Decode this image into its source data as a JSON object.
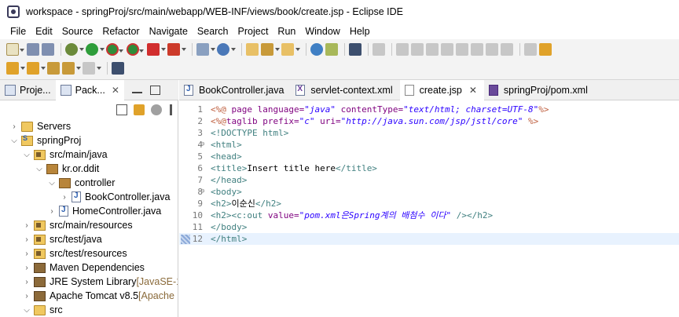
{
  "window": {
    "title": "workspace - springProj/src/main/webapp/WEB-INF/views/book/create.jsp - Eclipse IDE"
  },
  "menu": [
    "File",
    "Edit",
    "Source",
    "Refactor",
    "Navigate",
    "Search",
    "Project",
    "Run",
    "Window",
    "Help"
  ],
  "left_panel": {
    "tabs": [
      {
        "label": "Proje...",
        "active": false
      },
      {
        "label": "Pack...",
        "active": true
      }
    ]
  },
  "tree": [
    {
      "label": "Servers",
      "depth": 0,
      "twisty": "collapsed",
      "icon": "folder-icon"
    },
    {
      "label": "springProj",
      "depth": 0,
      "twisty": "expanded",
      "icon": "project-icon"
    },
    {
      "label": "src/main/java",
      "depth": 1,
      "twisty": "expanded",
      "icon": "source-folder-icon"
    },
    {
      "label": "kr.or.ddit",
      "depth": 2,
      "twisty": "expanded",
      "icon": "package-icon"
    },
    {
      "label": "controller",
      "depth": 3,
      "twisty": "expanded",
      "icon": "package-icon"
    },
    {
      "label": "BookController.java",
      "depth": 4,
      "twisty": "collapsed",
      "icon": "java-file-icon"
    },
    {
      "label": "HomeController.java",
      "depth": 3,
      "twisty": "collapsed",
      "icon": "java-file-icon"
    },
    {
      "label": "src/main/resources",
      "depth": 1,
      "twisty": "collapsed",
      "icon": "source-folder-icon"
    },
    {
      "label": "src/test/java",
      "depth": 1,
      "twisty": "collapsed",
      "icon": "source-folder-icon"
    },
    {
      "label": "src/test/resources",
      "depth": 1,
      "twisty": "collapsed",
      "icon": "source-folder-icon"
    },
    {
      "label": "Maven Dependencies",
      "depth": 1,
      "twisty": "collapsed",
      "icon": "library-icon"
    },
    {
      "label": "JRE System Library",
      "decoration": "[JavaSE-1",
      "depth": 1,
      "twisty": "collapsed",
      "icon": "library-icon"
    },
    {
      "label": "Apache Tomcat v8.5",
      "decoration": "[Apache",
      "depth": 1,
      "twisty": "collapsed",
      "icon": "library-icon"
    },
    {
      "label": "src",
      "depth": 1,
      "twisty": "expanded",
      "icon": "folder-icon"
    }
  ],
  "editor": {
    "tabs": [
      {
        "label": "BookController.java",
        "icon": "java-file-icon",
        "active": false,
        "closable": false
      },
      {
        "label": "servlet-context.xml",
        "icon": "xml-file-icon",
        "active": false,
        "closable": false
      },
      {
        "label": "create.jsp",
        "icon": "jsp-file-icon",
        "active": true,
        "closable": true
      },
      {
        "label": "springProj/pom.xml",
        "icon": "maven-file-icon",
        "active": false,
        "closable": false
      }
    ],
    "close_glyph": "✕",
    "current_line": 12,
    "lines": [
      {
        "n": "1",
        "fold": "",
        "segs": [
          [
            "dir",
            "<%@ "
          ],
          [
            "attr",
            "page "
          ],
          [
            "attr",
            "language="
          ],
          [
            "str",
            "\"java\""
          ],
          [
            "attr",
            " contentType="
          ],
          [
            "str",
            "\"text/html; charset=UTF-8\""
          ],
          [
            "dir",
            "%>"
          ]
        ]
      },
      {
        "n": "2",
        "fold": "",
        "segs": [
          [
            "dir",
            "<%@"
          ],
          [
            "attr",
            "taglib "
          ],
          [
            "attr",
            "prefix="
          ],
          [
            "str",
            "\"c\""
          ],
          [
            "attr",
            " uri="
          ],
          [
            "str",
            "\"http://java.sun.com/jsp/jstl/core\""
          ],
          [
            "dir",
            " %>"
          ]
        ]
      },
      {
        "n": "3",
        "fold": "",
        "segs": [
          [
            "tag",
            "<!DOCTYPE html>"
          ]
        ]
      },
      {
        "n": "4",
        "fold": "⊖",
        "segs": [
          [
            "tag",
            "<html>"
          ]
        ]
      },
      {
        "n": "5",
        "fold": "",
        "segs": [
          [
            "tag",
            "<head>"
          ]
        ]
      },
      {
        "n": "6",
        "fold": "",
        "segs": [
          [
            "tag",
            "<title>"
          ],
          [
            "txt",
            "Insert title here"
          ],
          [
            "tag",
            "</title>"
          ]
        ]
      },
      {
        "n": "7",
        "fold": "",
        "segs": [
          [
            "tag",
            "</head>"
          ]
        ]
      },
      {
        "n": "8",
        "fold": "⊖",
        "segs": [
          [
            "tag",
            "<body>"
          ]
        ]
      },
      {
        "n": "9",
        "fold": "",
        "segs": [
          [
            "tag",
            "<h2>"
          ],
          [
            "txt",
            "이순신"
          ],
          [
            "tag",
            "</h2>"
          ]
        ]
      },
      {
        "n": "10",
        "fold": "",
        "segs": [
          [
            "tag",
            "<h2><c:out "
          ],
          [
            "attr",
            "value="
          ],
          [
            "str",
            "\"pom.xml은Spring계의 배첨수 이다\""
          ],
          [
            "tag",
            " /></h2>"
          ]
        ]
      },
      {
        "n": "11",
        "fold": "",
        "segs": [
          [
            "tag",
            "</body>"
          ]
        ]
      },
      {
        "n": "12",
        "fold": "",
        "segs": [
          [
            "tag",
            "</html>"
          ]
        ]
      }
    ]
  },
  "colors": {
    "directive": "#bf5f3f",
    "attribute": "#7f007f",
    "string": "#2a00ff",
    "tag": "#3f7f7f",
    "current_line_bg": "#e8f2fe"
  }
}
